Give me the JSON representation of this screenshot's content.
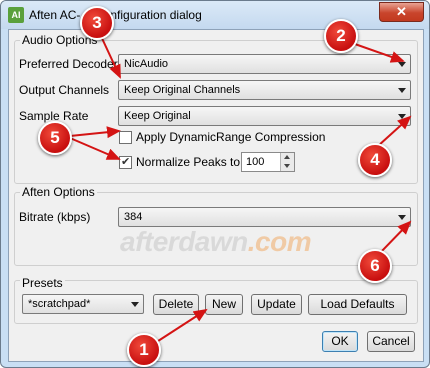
{
  "window": {
    "title": "Aften AC-3 Configuration dialog",
    "title_visible": "Aften AC-",
    "title_tail": "nfiguration dialog",
    "app_icon_text": "AI",
    "close_label": "✕"
  },
  "audio_options": {
    "group_label": "Audio Options",
    "preferred_decoder": {
      "label": "Preferred Decoder",
      "value": "NicAudio"
    },
    "output_channels": {
      "label": "Output Channels",
      "value": "Keep Original Channels"
    },
    "sample_rate": {
      "label": "Sample Rate",
      "value": "Keep Original"
    },
    "drc": {
      "label": "Apply DynamicRange Compression",
      "checked": false
    },
    "normalize": {
      "label": "Normalize Peaks to",
      "checked": true,
      "value": "100"
    }
  },
  "aften_options": {
    "group_label": "Aften Options",
    "bitrate": {
      "label": "Bitrate (kbps)",
      "value": "384"
    }
  },
  "watermark": {
    "main": "afterdawn",
    "tld": ".com"
  },
  "presets": {
    "group_label": "Presets",
    "selected": "*scratchpad*",
    "delete_label": "Delete",
    "new_label": "New",
    "update_label": "Update",
    "load_defaults_label": "Load Defaults"
  },
  "footer": {
    "ok_label": "OK",
    "cancel_label": "Cancel"
  },
  "annotations": {
    "color": "#d41414",
    "badges": [
      "1",
      "2",
      "3",
      "4",
      "5",
      "6"
    ]
  }
}
